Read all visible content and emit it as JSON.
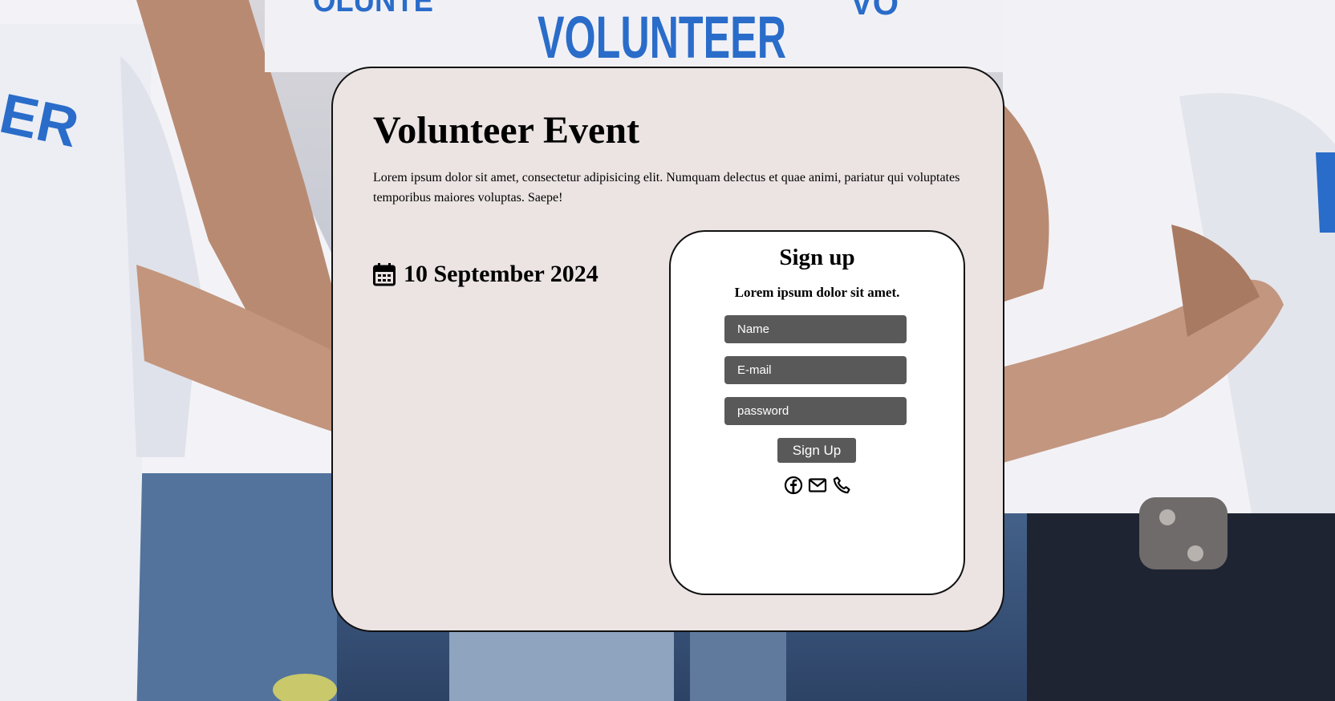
{
  "background": {
    "shirt_prints": [
      "VOLUNTEER",
      "VOLUNTEER",
      "VOLUNTEER"
    ],
    "colors": {
      "shirt": "#f2f2f6",
      "skin": "#b98a72",
      "denim": "#3e5a85",
      "print": "#2a6cc9"
    }
  },
  "event": {
    "title": "Volunteer Event",
    "description": "Lorem ipsum dolor sit amet, consectetur adipisicing elit. Numquam delectus et quae animi, pariatur qui voluptates temporibus maiores voluptas. Saepe!",
    "date": "10 September 2024",
    "date_icon": "calendar-icon"
  },
  "signup": {
    "title": "Sign up",
    "subtitle": "Lorem ipsum dolor sit amet.",
    "fields": {
      "name_placeholder": "Name",
      "email_placeholder": "E-mail",
      "password_placeholder": "password"
    },
    "button_label": "Sign Up",
    "social_icons": [
      "facebook-icon",
      "mail-icon",
      "phone-icon"
    ]
  },
  "colors": {
    "card_bg": "#ebe4e3",
    "panel_bg": "#ffffff",
    "input_bg": "#595959",
    "text": "#000000",
    "border": "#111111"
  }
}
